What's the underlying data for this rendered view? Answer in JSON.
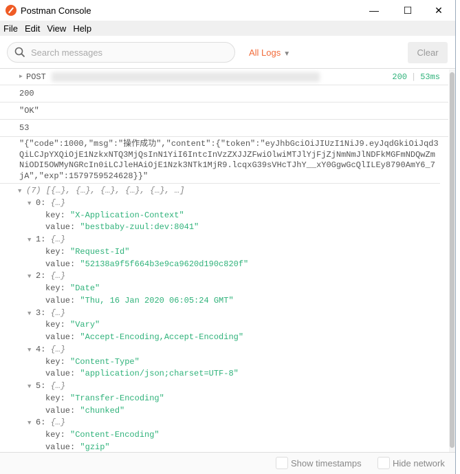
{
  "window": {
    "title": "Postman Console",
    "controls": [
      "—",
      "☐",
      "✕"
    ]
  },
  "menu": [
    "File",
    "Edit",
    "View",
    "Help"
  ],
  "toolbar": {
    "search_placeholder": "Search messages",
    "search_value": "",
    "filter": "All Logs",
    "clear": "Clear"
  },
  "colors": {
    "accent": "#f26b3a",
    "string": "#2fb27a"
  },
  "request": {
    "method": "POST",
    "status": "200",
    "time": "53ms"
  },
  "rows": [
    "200",
    "\"OK\"",
    "53"
  ],
  "body": "\"{\"code\":1000,\"msg\":\"操作成功\",\"content\":{\"token\":\"eyJhbGciOiJIUzI1NiJ9.eyJqdGkiOiJqd3QiLCJpYXQiOjE1NzkxNTQ3MjQsInN1YiI6IntcInVzZXJJZFwiOlwiMTJlYjFjZjNmNmJlNDFkMGFmNDQwZmNiODI5OWMyNGRcIn0iLCJleHAiOjE1Nzk3NTk1MjR9.lcqxG39sVHcTJhY__xY0GgwGcQlILEy8790AmY6_7jA\",\"exp\":1579759524628}}\"",
  "tree": {
    "summary": "(7) [{…}, {…}, {…}, {…}, {…}, …]",
    "items": [
      {
        "index": "0:",
        "preview": "{…}",
        "key": "\"X-Application-Context\"",
        "value": "\"bestbaby-zuul:dev:8041\""
      },
      {
        "index": "1:",
        "preview": "{…}",
        "key": "\"Request-Id\"",
        "value": "\"52138a9f5f664b3e9ca9620d190c820f\""
      },
      {
        "index": "2:",
        "preview": "{…}",
        "key": "\"Date\"",
        "value": "\"Thu, 16 Jan 2020 06:05:24 GMT\""
      },
      {
        "index": "3:",
        "preview": "{…}",
        "key": "\"Vary\"",
        "value": "\"Accept-Encoding,Accept-Encoding\""
      },
      {
        "index": "4:",
        "preview": "{…}",
        "key": "\"Content-Type\"",
        "value": "\"application/json;charset=UTF-8\""
      },
      {
        "index": "5:",
        "preview": "{…}",
        "key": "\"Transfer-Encoding\"",
        "value": "\"chunked\""
      },
      {
        "index": "6:",
        "preview": "{…}",
        "key": "\"Content-Encoding\"",
        "value": "\"gzip\""
      }
    ],
    "key_label": "key: ",
    "value_label": "value: "
  },
  "footer": {
    "show_timestamps": "Show timestamps",
    "hide_network": "Hide network"
  }
}
